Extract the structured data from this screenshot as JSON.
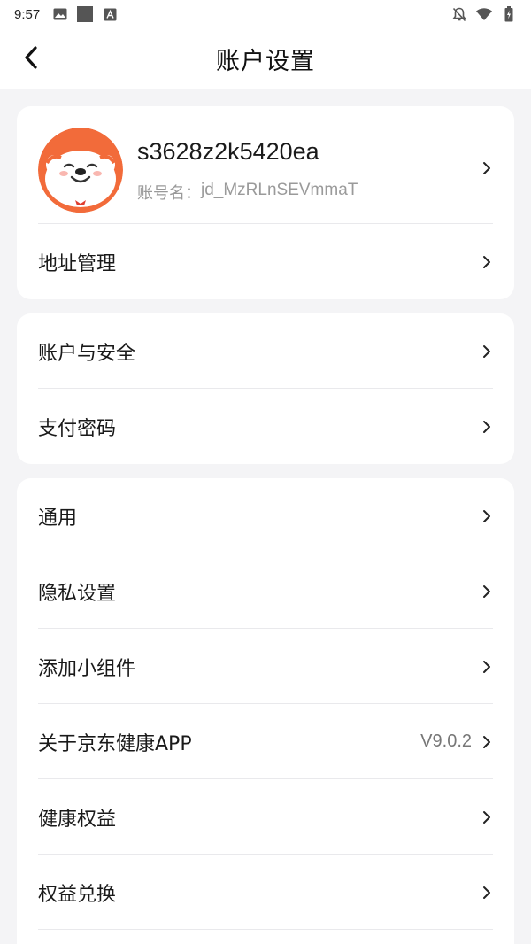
{
  "status_bar": {
    "time": "9:57",
    "left_icons": [
      "image-icon",
      "square-icon",
      "font-icon"
    ],
    "right_icons": [
      "notifications-off-icon",
      "wifi-icon",
      "battery-icon"
    ]
  },
  "header": {
    "title": "账户设置",
    "back_icon": "chevron-left-icon"
  },
  "profile": {
    "nickname": "s3628z2k5420ea",
    "account_label": "账号名：",
    "account_value": "jd_MzRLnSEVmmaT",
    "avatar_colors": {
      "ring": "#f26b3a",
      "face": "#ffffff"
    }
  },
  "card1": {
    "items": [
      {
        "label": "地址管理"
      }
    ]
  },
  "card2": {
    "items": [
      {
        "label": "账户与安全"
      },
      {
        "label": "支付密码"
      }
    ]
  },
  "card3": {
    "items": [
      {
        "label": "通用"
      },
      {
        "label": "隐私设置"
      },
      {
        "label": "添加小组件"
      },
      {
        "label": "关于京东健康APP",
        "value": "V9.0.2"
      },
      {
        "label": "健康权益"
      },
      {
        "label": "权益兑换"
      }
    ]
  },
  "colors": {
    "background": "#f4f4f6",
    "card": "#ffffff",
    "text_primary": "#1a1a1a",
    "text_secondary": "#999999",
    "avatar_orange": "#f26b3a"
  }
}
